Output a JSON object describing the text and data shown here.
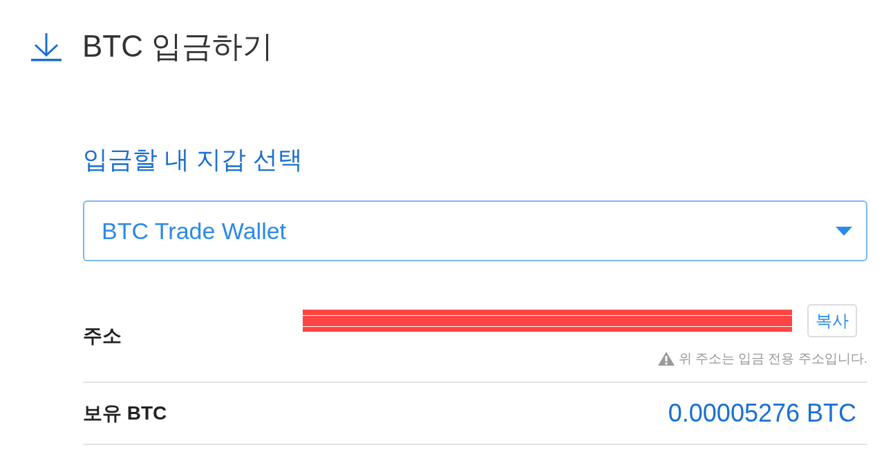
{
  "header": {
    "title": "BTC 입금하기"
  },
  "wallet_select": {
    "label": "입금할 내 지갑 선택",
    "value": "BTC Trade Wallet"
  },
  "address_row": {
    "label": "주소",
    "copy_button": "복사",
    "note": "위 주소는 입금 전용 주소입니다."
  },
  "balance_row": {
    "label": "보유 BTC",
    "value": "0.00005276 BTC"
  }
}
